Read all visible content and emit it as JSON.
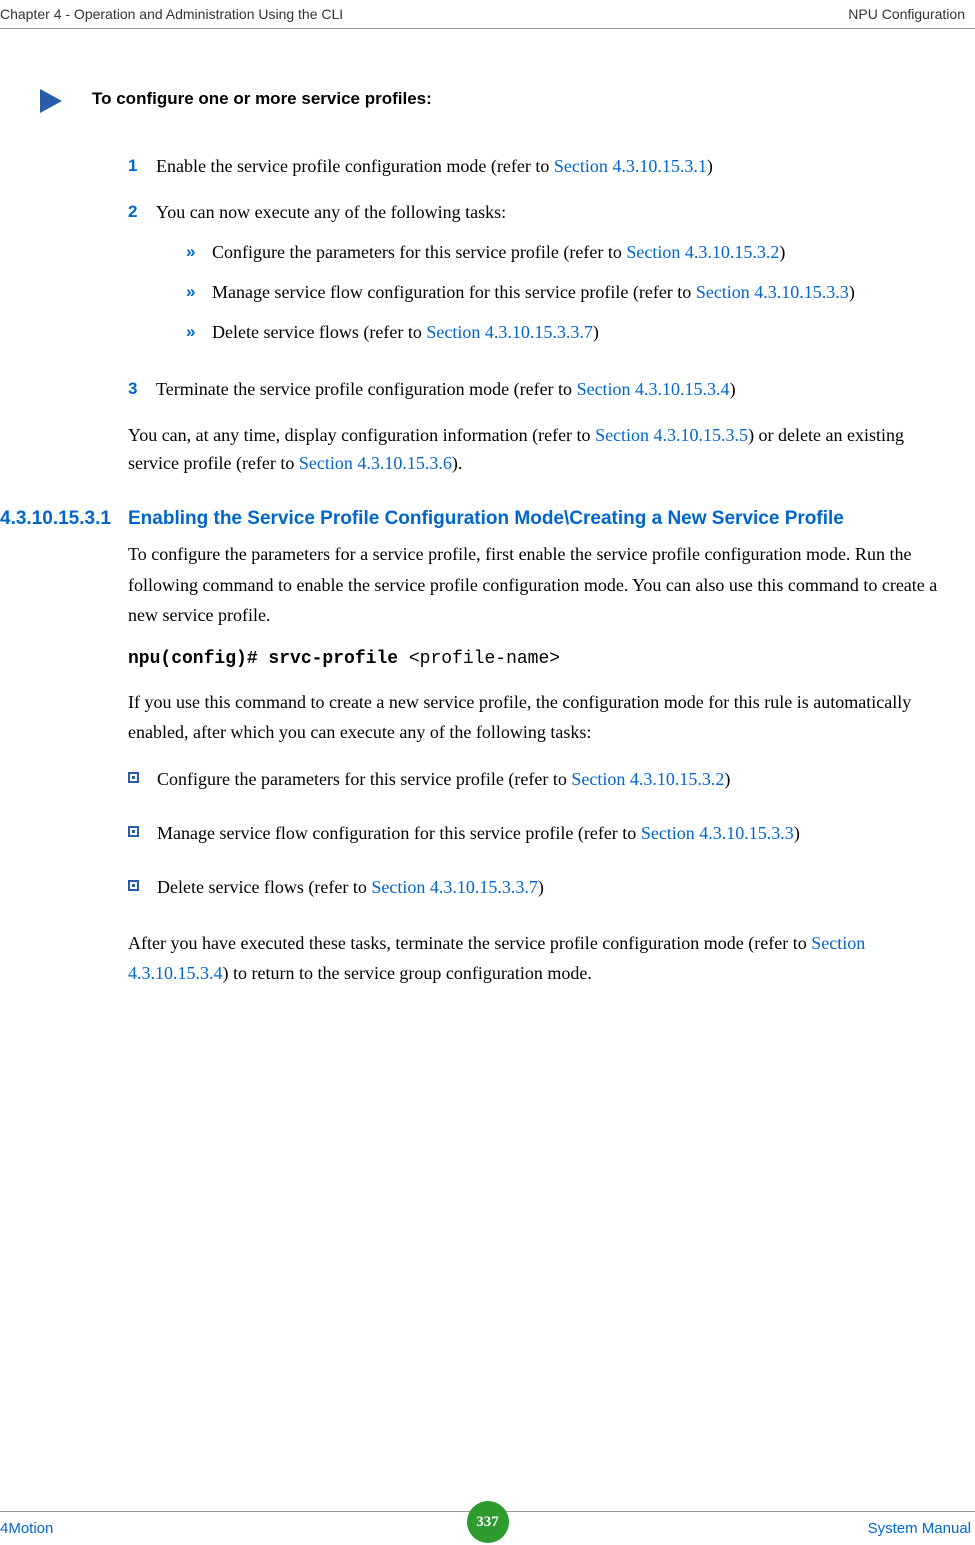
{
  "header": {
    "left": "Chapter 4 - Operation and Administration Using the CLI",
    "right": "NPU Configuration"
  },
  "intro": "To configure one or more service profiles:",
  "steps": {
    "s1": {
      "num": "1",
      "text": "Enable the service profile configuration mode (refer to ",
      "link": "Section 4.3.10.15.3.1",
      "after": ")"
    },
    "s2": {
      "num": "2",
      "text": "You can now execute any of the following tasks:",
      "a": {
        "text": "Configure the parameters for this service profile (refer to ",
        "link": "Section 4.3.10.15.3.2",
        "after": ")"
      },
      "b": {
        "text": "Manage service flow configuration for this service profile (refer to ",
        "link": "Section 4.3.10.15.3.3",
        "after": ")"
      },
      "c": {
        "text": "Delete service flows (refer to ",
        "link": "Section 4.3.10.15.3.3.7",
        "after": ")"
      }
    },
    "s3": {
      "num": "3",
      "text": "Terminate the service profile configuration mode (refer to ",
      "link": "Section 4.3.10.15.3.4",
      "after": ")"
    }
  },
  "after_steps": {
    "p1": "You can, at any time, display configuration information (refer to ",
    "l1": "Section 4.3.10.15.3.5",
    "p2": ") or delete an existing service profile (refer to ",
    "l2": "Section 4.3.10.15.3.6",
    "p3": ")."
  },
  "section": {
    "num": "4.3.10.15.3.1",
    "title": "Enabling the Service Profile Configuration Mode\\Creating a New Service Profile"
  },
  "body": {
    "p1": "To configure the parameters for a service profile, first enable the service profile configuration mode. Run the following command to enable the service profile configuration mode. You can also use this command to create a new service profile.",
    "code_bold": "npu(config)# srvc-profile ",
    "code_rest": "<profile-name>",
    "p2": "If you use this command to create a new service profile, the configuration mode for this rule is automatically enabled, after which you can execute any of the following tasks:"
  },
  "bullets": {
    "b1": {
      "text": "Configure the parameters for this service profile (refer to ",
      "link": "Section 4.3.10.15.3.2",
      "after": ")"
    },
    "b2": {
      "text": "Manage service flow configuration for this service profile (refer to ",
      "link": "Section 4.3.10.15.3.3",
      "after": ")"
    },
    "b3": {
      "text": "Delete service flows (refer to ",
      "link": "Section 4.3.10.15.3.3.7",
      "after": ")"
    }
  },
  "closing": {
    "p1": "After you have executed these tasks, terminate the service profile configuration mode (refer to ",
    "link": "Section 4.3.10.15.3.4",
    "p2": ") to return to the service group configuration mode."
  },
  "footer": {
    "left": "4Motion",
    "page": "337",
    "right": "System Manual"
  }
}
